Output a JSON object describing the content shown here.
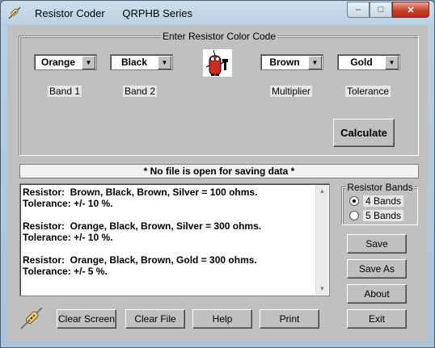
{
  "window": {
    "title": "Resistor Coder",
    "subtitle": "QRPHB Series",
    "minimize": "–",
    "maximize": "□",
    "close": "✕"
  },
  "entry": {
    "group_title": "Enter Resistor Color Code",
    "band1": {
      "value": "Orange",
      "label": "Band 1"
    },
    "band2": {
      "value": "Black",
      "label": "Band 2"
    },
    "multiplier": {
      "value": "Brown",
      "label": "Multiplier"
    },
    "tolerance": {
      "value": "Gold",
      "label": "Tolerance"
    },
    "calculate": "Calculate",
    "logo": "resistor-mascot-icon"
  },
  "status": "* No file is open for saving data *",
  "output": {
    "lines": [
      "Resistor:  Brown, Black, Brown, Silver = 100 ohms.",
      "Tolerance: +/- 10 %.",
      "",
      "Resistor:  Orange, Black, Brown, Silver = 300 ohms.",
      "Tolerance: +/- 10 %.",
      "",
      "Resistor:  Orange, Black, Brown, Gold = 300 ohms.",
      "Tolerance: +/- 5 %."
    ]
  },
  "bands": {
    "title": "Resistor Bands",
    "four": "4  Bands",
    "five": "5  Bands",
    "selected": "4"
  },
  "side_buttons": {
    "save": "Save",
    "save_as": "Save As",
    "about": "About",
    "exit": "Exit"
  },
  "bottom_buttons": {
    "clear_screen": "Clear Screen",
    "clear_file": "Clear File",
    "help": "Help",
    "print": "Print"
  },
  "colors": {
    "accent_close": "#c8412b",
    "face": "#c0c0c0"
  }
}
